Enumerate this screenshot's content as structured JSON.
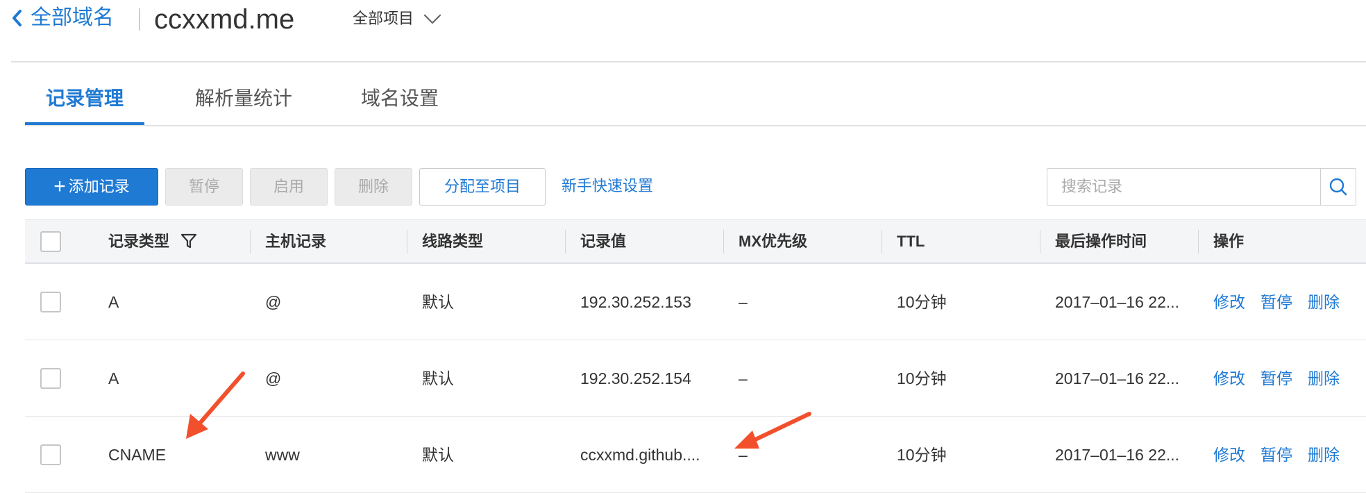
{
  "header": {
    "back_label": "全部域名",
    "domain": "ccxxmd.me",
    "project_select": "全部项目"
  },
  "tabs": [
    {
      "label": "记录管理",
      "active": true
    },
    {
      "label": "解析量统计",
      "active": false
    },
    {
      "label": "域名设置",
      "active": false
    }
  ],
  "toolbar": {
    "add_plus": "+",
    "add_label": "添加记录",
    "pause_label": "暂停",
    "enable_label": "启用",
    "delete_label": "删除",
    "assign_label": "分配至项目",
    "quick_setup_label": "新手快速设置"
  },
  "search": {
    "placeholder": "搜索记录"
  },
  "table": {
    "columns": [
      "记录类型",
      "主机记录",
      "线路类型",
      "记录值",
      "MX优先级",
      "TTL",
      "最后操作时间",
      "操作"
    ],
    "rows": [
      {
        "type": "A",
        "host": "@",
        "line": "默认",
        "value": "192.30.252.153",
        "mx": "–",
        "ttl": "10分钟",
        "time": "2017–01–16 22...",
        "ops": [
          "修改",
          "暂停",
          "删除"
        ]
      },
      {
        "type": "A",
        "host": "@",
        "line": "默认",
        "value": "192.30.252.154",
        "mx": "–",
        "ttl": "10分钟",
        "time": "2017–01–16 22...",
        "ops": [
          "修改",
          "暂停",
          "删除"
        ]
      },
      {
        "type": "CNAME",
        "host": "www",
        "line": "默认",
        "value": "ccxxmd.github....",
        "mx": "–",
        "ttl": "10分钟",
        "time": "2017–01–16 22...",
        "ops": [
          "修改",
          "暂停",
          "删除"
        ]
      }
    ]
  },
  "colors": {
    "accent": "#1f7ad4",
    "annotation_arrow": "#f2502d"
  }
}
